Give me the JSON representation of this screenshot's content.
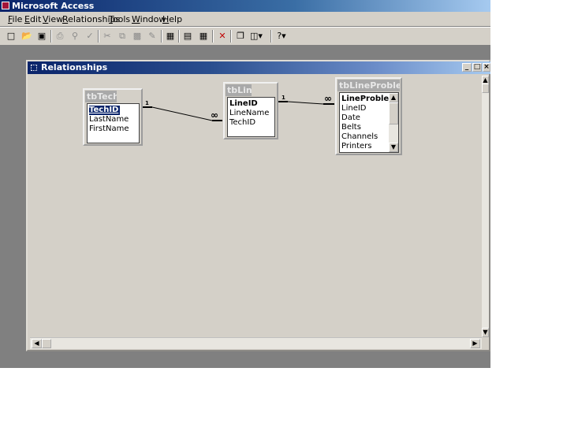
{
  "app": {
    "title": "Microsoft Access",
    "menu": [
      "File",
      "Edit",
      "View",
      "Relationships",
      "Tools",
      "Window",
      "Help"
    ],
    "toolbar_icons": [
      "new-icon",
      "open-icon",
      "save-icon",
      "print-icon",
      "print-preview-icon",
      "spelling-icon",
      "cut-icon",
      "copy-icon",
      "paste-icon",
      "format-painter-icon",
      "show-table-icon",
      "show-direct-icon",
      "show-all-icon",
      "delete-icon",
      "new-object-icon",
      "office-links-icon",
      "help-icon"
    ]
  },
  "relationships_window": {
    "title": "Relationships",
    "tables": [
      {
        "name": "tbTechs",
        "fields": [
          "TechID",
          "LastName",
          "FirstName"
        ]
      },
      {
        "name": "tbLine",
        "fields": [
          "LineID",
          "LineName",
          "TechID"
        ]
      },
      {
        "name": "tbLineProblems",
        "fields": [
          "LineProblemsID",
          "LineID",
          "Date",
          "Belts",
          "Channels",
          "Printers"
        ]
      }
    ],
    "relationships": [
      {
        "from": "tbTechs.TechID",
        "to": "tbLine.TechID",
        "one_label": "1",
        "many_label": "∞"
      },
      {
        "from": "tbLineProblems.LineID",
        "to": "tbLine.LineID",
        "one_label": "1",
        "many_label": "∞"
      }
    ]
  },
  "colors": {
    "title_active": "#0a246a",
    "face": "#d4d0c8",
    "mdi_background": "#808080",
    "selection": "#0a246a"
  }
}
